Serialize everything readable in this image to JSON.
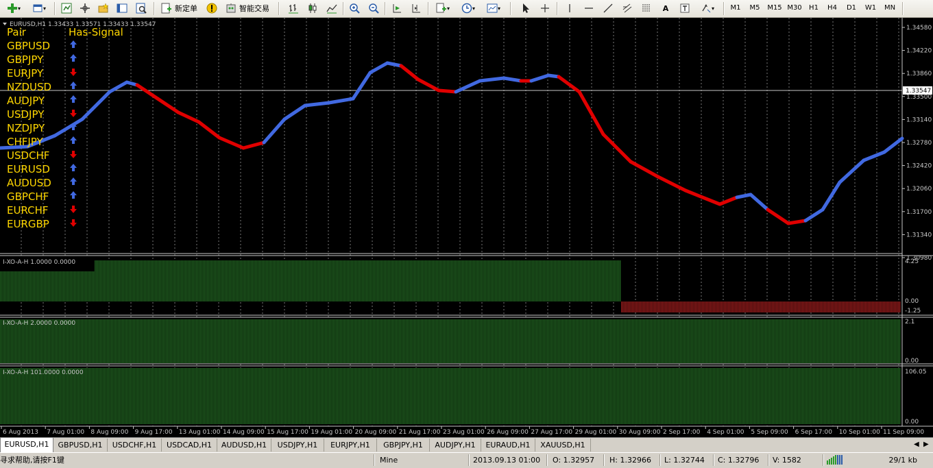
{
  "toolbar": {
    "new_order_label": "新定单",
    "auto_trading_label": "智能交易",
    "timeframes": [
      "M1",
      "M5",
      "M15",
      "M30",
      "H1",
      "H4",
      "D1",
      "W1",
      "MN"
    ]
  },
  "chart": {
    "header": "EURUSD,H1  1.33433 1.33571 1.33433 1.33547",
    "current_price": "1.33547",
    "price_axis": [
      "1.34580",
      "1.34220",
      "1.33860",
      "1.33500",
      "1.33140",
      "1.32780",
      "1.32420",
      "1.32060",
      "1.31700",
      "1.31340",
      "1.30980"
    ],
    "signal_table": {
      "col_pair": "Pair",
      "col_signal": "Has-Signal",
      "rows": [
        {
          "pair": "GBPUSD",
          "signal": "up"
        },
        {
          "pair": "GBPJPY",
          "signal": "up"
        },
        {
          "pair": "EURJPY",
          "signal": "down"
        },
        {
          "pair": "NZDUSD",
          "signal": "up"
        },
        {
          "pair": "AUDJPY",
          "signal": "up"
        },
        {
          "pair": "USDJPY",
          "signal": "down"
        },
        {
          "pair": "NZDJPY",
          "signal": "up"
        },
        {
          "pair": "CHFJPY",
          "signal": "up"
        },
        {
          "pair": "USDCHF",
          "signal": "down"
        },
        {
          "pair": "EURUSD",
          "signal": "up"
        },
        {
          "pair": "AUDUSD",
          "signal": "up"
        },
        {
          "pair": "GBPCHF",
          "signal": "up"
        },
        {
          "pair": "EURCHF",
          "signal": "down"
        },
        {
          "pair": "EURGBP",
          "signal": "down"
        }
      ]
    },
    "colors": {
      "up": "#4169e1",
      "down": "#e00000",
      "text": "#ffd700",
      "histo_green": "#1e5a1e",
      "histo_red": "#8b1a1a",
      "grid": "#c8c8c8"
    },
    "subwindows": [
      {
        "label": "I-XO-A-H 1.0000 0.0000",
        "axis": [
          "4.25",
          "0.00",
          "-1.25"
        ]
      },
      {
        "label": "I-XO-A-H 2.0000 0.0000",
        "axis": [
          "2.1",
          "0.00"
        ]
      },
      {
        "label": "I-XO-A-H 101.0000 0.0000",
        "axis": [
          "106.05",
          "0.00"
        ]
      }
    ],
    "time_axis": [
      "6 Aug 2013",
      "7 Aug 01:00",
      "8 Aug 09:00",
      "9 Aug 17:00",
      "13 Aug 01:00",
      "14 Aug 09:00",
      "15 Aug 17:00",
      "19 Aug 01:00",
      "20 Aug 09:00",
      "21 Aug 17:00",
      "23 Aug 01:00",
      "26 Aug 09:00",
      "27 Aug 17:00",
      "29 Aug 01:00",
      "30 Aug 09:00",
      "2 Sep 17:00",
      "4 Sep 01:00",
      "5 Sep 09:00",
      "6 Sep 17:00",
      "10 Sep 01:00",
      "11 Sep 09:00"
    ]
  },
  "tabs": [
    "EURUSD,H1",
    "GBPUSD,H1",
    "USDCHF,H1",
    "USDCAD,H1",
    "AUDUSD,H1",
    "USDJPY,H1",
    "EURJPY,H1",
    "GBPJPY,H1",
    "AUDJPY,H1",
    "EURAUD,H1",
    "XAUUSD,H1"
  ],
  "status": {
    "help": "寻求帮助,请按F1键",
    "profile": "Mine",
    "datetime": "2013.09.13 01:00",
    "open": "O: 1.32957",
    "high": "H: 1.32966",
    "low": "L: 1.32744",
    "close": "C: 1.32796",
    "volume": "V: 1582",
    "traffic": "29/1 kb"
  }
}
